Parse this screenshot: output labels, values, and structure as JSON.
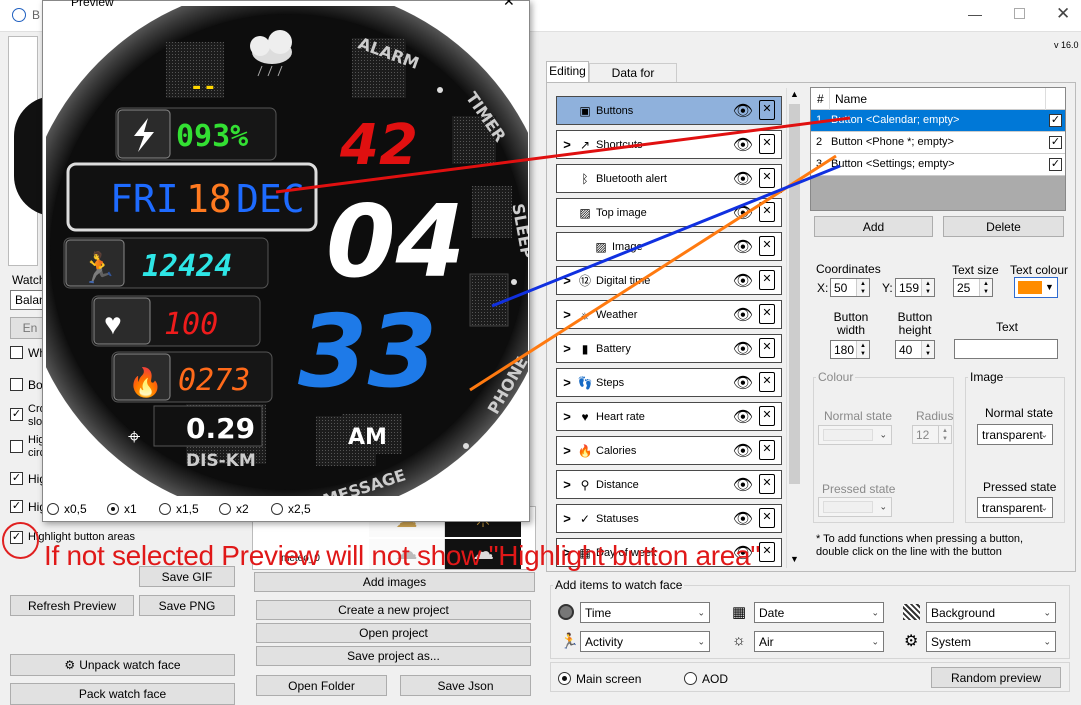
{
  "window": {
    "title_fragment": "B",
    "version": "v 16.0"
  },
  "preview_window": {
    "title": "Preview"
  },
  "tabs": [
    {
      "label": "Editing"
    },
    {
      "label": "Data for preview"
    }
  ],
  "elements": [
    {
      "label": "Buttons",
      "icon": "buttons-icon",
      "chevron": false,
      "selected": true
    },
    {
      "label": "Shortcuts",
      "icon": "shortcut-icon",
      "chevron": true
    },
    {
      "label": "Bluetooth alert",
      "icon": "bluetooth-icon",
      "chevron": false
    },
    {
      "label": "Top image",
      "icon": "image-icon",
      "chevron": false
    },
    {
      "label": "Image",
      "icon": "image-icon",
      "chevron": false
    },
    {
      "label": "Digital time",
      "icon": "digital-time-icon",
      "chevron": true
    },
    {
      "label": "Weather",
      "icon": "weather-icon",
      "chevron": true
    },
    {
      "label": "Battery",
      "icon": "battery-icon",
      "chevron": true
    },
    {
      "label": "Steps",
      "icon": "steps-icon",
      "chevron": true
    },
    {
      "label": "Heart rate",
      "icon": "heart-icon",
      "chevron": true
    },
    {
      "label": "Calories",
      "icon": "fire-icon",
      "chevron": true
    },
    {
      "label": "Distance",
      "icon": "location-icon",
      "chevron": true
    },
    {
      "label": "Statuses",
      "icon": "status-icon",
      "chevron": true
    },
    {
      "label": "Day of week",
      "icon": "calendar-icon",
      "chevron": true
    }
  ],
  "buttons_table": {
    "headers": [
      "#",
      "Name"
    ],
    "rows": [
      {
        "num": "1",
        "name": "Button <Calendar; empty>",
        "checked": true
      },
      {
        "num": "2",
        "name": "Button <Phone *; empty>",
        "checked": true
      },
      {
        "num": "3",
        "name": "Button <Settings; empty>",
        "checked": true
      }
    ],
    "add_label": "Add",
    "delete_label": "Delete"
  },
  "props": {
    "coordinates_label": "Coordinates",
    "x_label": "X:",
    "x_value": "50",
    "y_label": "Y:",
    "y_value": "159",
    "text_size_label": "Text size",
    "text_size_value": "25",
    "text_colour_label": "Text colour",
    "text_colour": "#ff8c00",
    "button_width_label": "Button width",
    "button_width_value": "180",
    "button_height_label": "Button height",
    "button_height_value": "40",
    "text_label": "Text",
    "text_value": "",
    "colour_group": "Colour",
    "normal_state_label": "Normal state",
    "radius_label": "Radius",
    "radius_value": "12",
    "pressed_state_label": "Pressed state",
    "image_group": "Image",
    "image_normal_state_label": "Normal state",
    "image_normal_value": "transparent",
    "image_pressed_state_label": "Pressed state",
    "image_pressed_value": "transparent",
    "hint": "* To add functions when pressing a button, double click on the line with the button"
  },
  "add_items": {
    "title": "Add items to watch face",
    "dropdowns": [
      {
        "label": "Time",
        "icon": "clock-icon"
      },
      {
        "label": "Date",
        "icon": "calendar-icon"
      },
      {
        "label": "Background",
        "icon": "background-icon"
      },
      {
        "label": "Activity",
        "icon": "activity-icon"
      },
      {
        "label": "Air",
        "icon": "air-icon"
      },
      {
        "label": "System",
        "icon": "system-icon"
      }
    ],
    "main_screen": "Main screen",
    "aod": "AOD",
    "random_preview": "Random preview"
  },
  "left_panel": {
    "watch_label": "Watch",
    "watch_value": "Balanc",
    "en_button": "En",
    "checkboxes": [
      {
        "label": "Wh",
        "checked": false
      },
      {
        "label": "Bo",
        "checked": false
      },
      {
        "label": "Cro",
        "label2": "slo",
        "checked": true
      },
      {
        "label": "Hig",
        "label2": "circ",
        "checked": false
      },
      {
        "label": "Hig",
        "checked": true
      },
      {
        "label": "Hig",
        "checked": true
      },
      {
        "label": "Highlight button areas",
        "checked": true
      }
    ],
    "save_gif": "Save GIF",
    "refresh_preview": "Refresh Preview",
    "save_png": "Save PNG",
    "unpack": "Unpack watch face",
    "pack": "Pack watch face"
  },
  "images_panel": {
    "add_images": "Add images",
    "create_project": "Create a new project",
    "open_project": "Open project",
    "save_project_as": "Save project as...",
    "open_folder": "Open Folder",
    "save_json": "Save Json",
    "partial_file": "meteo_0"
  },
  "zoom": {
    "options": [
      "x0,5",
      "x1",
      "x1,5",
      "x2",
      "x2,5"
    ],
    "selected": "x1"
  },
  "watch": {
    "weather_dashes": "--",
    "battery": "093%",
    "date_day": "FRI",
    "date_num": "18",
    "date_mon": "DEC",
    "steps": "12424",
    "heart": "100",
    "calories": "0273",
    "distance": "0.29",
    "distance_unit": "DIS-KM",
    "sec": "42",
    "hour": "04",
    "minute": "33",
    "ampm": "AM",
    "ring_alarm": "ALARM",
    "ring_timer": "TIMER",
    "ring_sleep": "SLEEP",
    "ring_phone": "PHONE",
    "ring_message": "MESSAGE"
  },
  "annotation": "If not selected Preview will not show \"Highlight button area\""
}
